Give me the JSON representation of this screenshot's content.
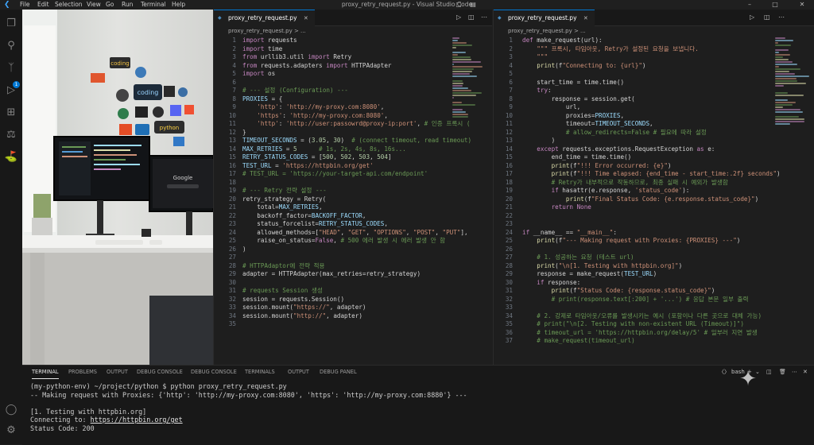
{
  "titlebar": {
    "menus": [
      "File",
      "Edit",
      "Selection",
      "View",
      "Go",
      "Run",
      "Terminal",
      "Help"
    ],
    "title": "proxy_retry_request.py - Visual Studio Code",
    "minimize": "–",
    "maximize": "□",
    "close": "✕"
  },
  "activity": {
    "badge": "1"
  },
  "left_editor": {
    "tab_label": "proxy_retry_request.py",
    "breadcrumb": "proxy_retry_request.py > ...",
    "lines": [
      "import requests",
      "import time",
      "from urllib3.util import Retry",
      "from requests.adapters import HTTPAdapter",
      "import os",
      "",
      "# --- 설정 (Configuration) ---",
      "PROXIES = {",
      "    'http': 'http://my-proxy.com:8080',",
      "    'https': 'http://my-proxy.com:8080',",
      "    'http': 'http://user:passowrd@proxy-ip:port', # 인증 프록시 (",
      "}",
      "TIMEOUT_SECONDS = (3.05, 30)  # (connect timeout, read timeout)",
      "MAX_RETRIES = 5      # 1s, 2s, 4s, 8s, 16s...",
      "RETRY_STATUS_CODES = [500, 502, 503, 504]",
      "TEST_URL = 'https://httpbin.org/get'",
      "# TEST_URL = 'https://your-target-api.com/endpoint'",
      "",
      "# --- Retry 전략 설정 ---",
      "retry_strategy = Retry(",
      "    total=MAX_RETRIES,",
      "    backoff_factor=BACKOFF_FACTOR,",
      "    status_forcelist=RETRY_STATUS_CODES,",
      "    allowed_methods=[\"HEAD\", \"GET\", \"OPTIONS\", \"POST\", \"PUT\"],",
      "    raise_on_status=False, # 500 에러 발생 시 에러 발생 안 함",
      ")",
      "",
      "# HTTPAdaptor에 전략 적용",
      "adapter = HTTPAdapter(max_retries=retry_strategy)",
      "",
      "# requests Session 생성",
      "session = requests.Session()",
      "session.mount(\"https://\", adapter)",
      "session.mount(\"http://\", adapter)",
      ""
    ]
  },
  "right_editor": {
    "tab_label": "proxy_retry_request.py",
    "breadcrumb": "proxy_retry_request.py > ...",
    "line_start": 1,
    "lines": [
      "def make_request(url):",
      "    \"\"\" 프록시, 타임아웃, Retry가 설정된 요청을 보냅니다.",
      "    \"\"\"",
      "    print(f\"Connecting to: {url}\")",
      "",
      "    start_time = time.time()",
      "    try:",
      "        response = session.get(",
      "            url,",
      "            proxies=PROXIES,",
      "            timeout=TIMEOUT_SECONDS,",
      "            # allow_redirects=False # 필요에 따라 설정",
      "        )",
      "    except requests.exceptions.RequestException as e:",
      "        end_time = time.time()",
      "        print(f\"!!! Error occurred: {e}\")",
      "        print(f\"!!! Time elapsed: {end_time - start_time:.2f} seconds\")",
      "        # Retry가 내부적으로 작동하므로, 최종 실패 시 예외가 발생함",
      "        if hasattr(e.response, 'status_code'):",
      "            print(f\"Final Status Code: {e.response.status_code}\")",
      "        return None",
      "",
      "",
      "if __name__ == \"__main__\":",
      "    print(f\"--- Making request with Proxies: {PROXIES} ---\")",
      "",
      "    # 1. 성공하는 요청 (테스트 url)",
      "    print(\"\\n[1. Testing with httpbin.org]\")",
      "    response = make_request(TEST_URL)",
      "    if response:",
      "        print(f\"Status Code: {response.status_code}\")",
      "        # print(response.text[:200] + '...') # 응답 본문 일부 출력",
      "",
      "    # 2. 강제로 타임아웃/오류를 발생시키는 예시 (포함이나 다른 곳으로 대체 가능)",
      "    # print(\"\\n[2. Testing with non-existent URL (Timeout)]\")",
      "    # timeout_url = 'https://httpbin.org/delay/5' # 일부러 지연 발생",
      "    # make_request(timeout_url)"
    ]
  },
  "panel": {
    "tabs": [
      "TERMINAL",
      "PROBLEMS",
      "OUTPUT",
      "DEBUG CONSOLE",
      "DEBUG CONSOLE",
      "TERMINALS",
      "OUTPUT",
      "DEBUG PANEL"
    ],
    "shell": "bash",
    "terminal_lines": [
      "(my-python-env) ~/project/python $ python proxy_retry_request.py",
      "-- Making request with Proxies: {'http': 'http://my-proxy.com:8080', 'https': 'http://my-proxy.com:8880'} ---",
      "",
      "[1. Testing with httpbin.org]",
      "Connecting to: https://httpbin.org/get",
      "Status Code: 200"
    ]
  },
  "photo": {
    "stickers": [
      "coding",
      "coding",
      "python"
    ],
    "screen_text": "Google"
  },
  "colors": {
    "accent": "#0078d4",
    "keyword": "#c586c0",
    "string": "#ce9178",
    "comment": "#6a9955",
    "function": "#dcdcaa",
    "variable": "#9cdcfe",
    "number": "#b5cea8",
    "builtin": "#4ec9b0"
  }
}
